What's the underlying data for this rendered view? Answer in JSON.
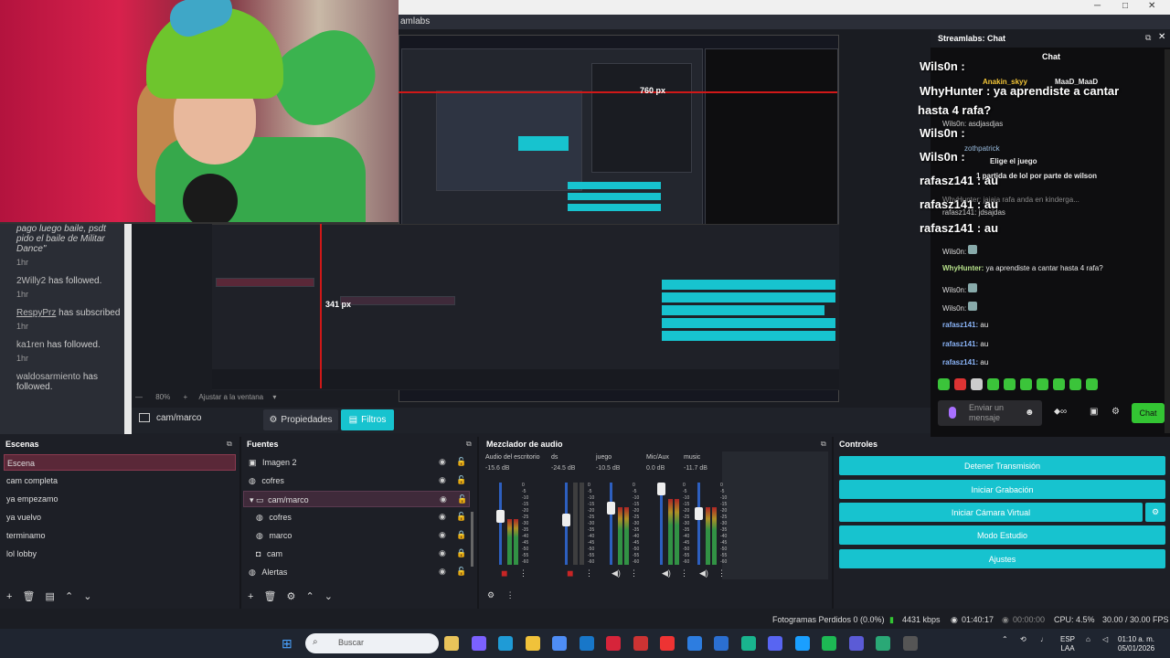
{
  "app": {
    "title": "Streamlabs",
    "title_partial": "amlabs"
  },
  "window_controls": {
    "minimize": "─",
    "maximize": "□",
    "close": "✕"
  },
  "preview": {
    "measure_h": "760 px",
    "measure_v": "341 px",
    "zoom": "80%",
    "fit_label": "Ajustar a la ventana"
  },
  "activity": [
    {
      "text": "pago luego baile, psdt pido el baile de Militar Dance\"",
      "time": "1hr"
    },
    {
      "name": "2Willy2",
      "action": "has followed.",
      "time": "1hr"
    },
    {
      "name": "RespyPrz",
      "action": "has subscribed",
      "time": "1hr"
    },
    {
      "name": "ka1ren",
      "action": "has followed.",
      "time": "1hr"
    },
    {
      "name": "waldosarmiento",
      "action": "has followed.",
      "time": ""
    }
  ],
  "source_toolbar": {
    "source_name": "cam/marco",
    "properties_label": "Propiedades",
    "filters_label": "Filtros"
  },
  "chat": {
    "header_title": "Streamlabs: Chat",
    "panel_title": "Chat",
    "overlay_big": [
      {
        "name": "Wils0n :",
        "msg": ""
      },
      {
        "name": "WhyHunter :",
        "msg": "ya aprendiste a cantar"
      },
      {
        "name": "",
        "msg": "hasta 4 rafa?"
      },
      {
        "name": "Wils0n :",
        "msg": ""
      },
      {
        "name": "Wils0n :",
        "msg": ""
      },
      {
        "name": "rafasz141 :",
        "msg": "au"
      },
      {
        "name": "rafasz141 :",
        "msg": "au"
      },
      {
        "name": "rafasz141 :",
        "msg": "au"
      }
    ],
    "overlay_small": [
      {
        "text": "Anakin_skyy"
      },
      {
        "text": "MaaD_MaaD"
      },
      {
        "text": "Wils0n: asdjasdjas"
      },
      {
        "text": "zothpatrick"
      },
      {
        "text": "Elige el juego"
      },
      {
        "text": "1 partida de lol por parte de wilson"
      },
      {
        "text": "WhyHunter: jajaja rafa anda en kindergа..."
      },
      {
        "text": "rafasz141: jdsajdas"
      }
    ],
    "messages": [
      {
        "user": "Wils0n:",
        "msg": ""
      },
      {
        "user": "WhyHunter:",
        "msg": "ya aprendiste a cantar hasta 4 rafa?"
      },
      {
        "user": "Wils0n:",
        "msg": ""
      },
      {
        "user": "Wils0n:",
        "msg": ""
      },
      {
        "user": "rafasz141:",
        "msg": "au"
      },
      {
        "user": "rafasz141:",
        "msg": "au"
      },
      {
        "user": "rafasz141:",
        "msg": "au"
      }
    ],
    "input_placeholder": "Enviar un mensaje",
    "send_label": "Chat"
  },
  "scenes": {
    "title": "Escenas",
    "items": [
      "Escena",
      "cam completa",
      "ya empezamo",
      "ya vuelvo",
      "terminamo",
      "lol lobby"
    ],
    "selected": "Escena"
  },
  "sources": {
    "title": "Fuentes",
    "items": [
      {
        "name": "Imagen 2",
        "icon": "image-icon"
      },
      {
        "name": "cofres",
        "icon": "browser-icon"
      },
      {
        "name": "cam/marco",
        "icon": "folder-icon"
      },
      {
        "name": "cofres",
        "icon": "browser-icon"
      },
      {
        "name": "marco",
        "icon": "browser-icon"
      },
      {
        "name": "cam",
        "icon": "camera-icon"
      },
      {
        "name": "Alertas",
        "icon": "browser-icon"
      }
    ]
  },
  "mixer": {
    "title": "Mezclador de audio",
    "channels": [
      {
        "name": "Audio del escritorio",
        "db": "-15.6 dB",
        "level": 0.55,
        "fader": 0.6
      },
      {
        "name": "ds",
        "db": "-24.5 dB",
        "level": 0.0,
        "fader": 0.55
      },
      {
        "name": "juego",
        "db": "-10.5 dB",
        "level": 0.7,
        "fader": 0.72
      },
      {
        "name": "Mic/Aux",
        "db": "0.0 dB",
        "level": 0.8,
        "fader": 1.0
      },
      {
        "name": "music",
        "db": "-11.7 dB",
        "level": 0.7,
        "fader": 0.65
      }
    ],
    "scale": [
      "0",
      "-5",
      "-10",
      "-15",
      "-20",
      "-25",
      "-30",
      "-35",
      "-40",
      "-45",
      "-50",
      "-55",
      "-60"
    ]
  },
  "controls": {
    "title": "Controles",
    "buttons": [
      "Detener Transmisión",
      "Iniciar Grabación",
      "Iniciar Cámara Virtual",
      "Modo Estudio",
      "Ajustes"
    ]
  },
  "status": {
    "dropped": "Fotogramas Perdidos 0 (0.0%)",
    "bitrate": "4431 kbps",
    "live_time": "01:40:17",
    "rec_time": "00:00:00",
    "cpu": "CPU: 4.5%",
    "fps": "30.00 / 30.00 FPS"
  },
  "taskbar": {
    "search_placeholder": "Buscar",
    "lang": "ESP",
    "lang2": "LAA",
    "time": "01:10 a. m.",
    "date": "05/01/2026"
  },
  "colors": {
    "accent": "#17c3cf",
    "live": "#33c533",
    "selected_scene": "#5a2838"
  }
}
